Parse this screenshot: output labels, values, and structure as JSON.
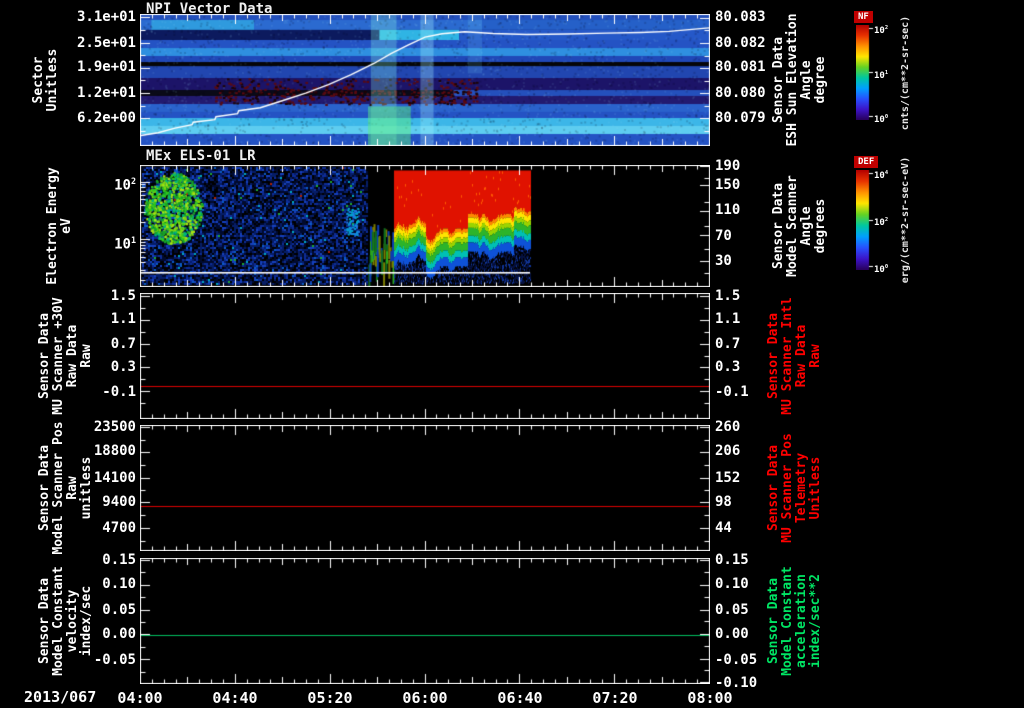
{
  "page": {
    "background": "#000000",
    "foreground": "#ffffff",
    "accent_red": "#ff0000",
    "accent_green": "#00e564"
  },
  "x_axis": {
    "date_label": "2013/067",
    "tick_labels": [
      "04:00",
      "04:40",
      "05:20",
      "06:00",
      "06:40",
      "07:20",
      "08:00"
    ]
  },
  "colorbars": [
    {
      "name": "NF",
      "units": "cnts/(cm**2-sr-sec)",
      "tick_labels": [
        "10^2",
        "10^1",
        "10^0"
      ],
      "tick_fracs": [
        0.03,
        0.5,
        0.97
      ],
      "gradient": [
        "#b40000",
        "#e83200",
        "#ff9100",
        "#ffe600",
        "#64d223",
        "#00c8a0",
        "#00a0ff",
        "#2850ff",
        "#3c14c8",
        "#28005a"
      ]
    },
    {
      "name": "DEF",
      "units": "erg/(cm**2-sr-sec-eV)",
      "tick_labels": [
        "10^4",
        "10^2",
        "10^0"
      ],
      "tick_fracs": [
        0.03,
        0.5,
        0.97
      ],
      "gradient": [
        "#b40000",
        "#e83200",
        "#ff9100",
        "#ffe600",
        "#64d223",
        "#00c8a0",
        "#00a0ff",
        "#2850ff",
        "#3c14c8",
        "#28005a"
      ]
    }
  ],
  "chart_data": [
    {
      "type": "heatmap",
      "title": "NPI Vector Data",
      "ylabel_lines": [
        "Sector",
        "Unitless"
      ],
      "y_ticks": [
        {
          "label": "3.1e+01",
          "frac": 0.023
        },
        {
          "label": "2.5e+01",
          "frac": 0.22
        },
        {
          "label": "1.9e+01",
          "frac": 0.409
        },
        {
          "label": "1.2e+01",
          "frac": 0.606
        },
        {
          "label": "6.2e+00",
          "frac": 0.795
        }
      ],
      "right_label_lines": [
        "Sensor Data",
        "ESH Sun Elevation",
        "Angle",
        "degree"
      ],
      "right_label_color": "#ffffff",
      "right_ticks": [
        {
          "label": "80.083",
          "frac": 0.03
        },
        {
          "label": "80.082",
          "frac": 0.22
        },
        {
          "label": "80.081",
          "frac": 0.409
        },
        {
          "label": "80.080",
          "frac": 0.606
        },
        {
          "label": "80.079",
          "frac": 0.795
        }
      ],
      "x_tick_labels": [
        "04:00",
        "04:40",
        "05:20",
        "06:00",
        "06:40",
        "07:20",
        "08:00"
      ],
      "description": "Sector vs time count-rate spectrogram; mostly blue/cyan horizontal bands, a full-width black row near sector 21 and a partial black row near sector 11, dark purple rows with maroon speckles between 04:30-05:30, bright cyan-green vertical enhancement near 05:50-06:05, white ESH sun-elevation trace rising from ~80.0785 deg at 04:00 to a ~80.082 deg plateau after 06:00.",
      "noise_seed": 42,
      "rows": [
        {
          "y0": 0.0,
          "y1": 0.045,
          "color": "#2450bc"
        },
        {
          "y0": 0.045,
          "y1": 0.12,
          "color": "#2b6ad0",
          "segs": [
            {
              "x0": 0.02,
              "x1": 0.2,
              "color": "#2f9ade"
            },
            {
              "x0": 0.6,
              "x1": 1.0,
              "color": "#2560c8"
            }
          ]
        },
        {
          "y0": 0.12,
          "y1": 0.197,
          "color": "#0c1a5e",
          "segs": [
            {
              "x0": 0.42,
              "x1": 0.56,
              "color": "#2fb4e4"
            },
            {
              "x0": 0.56,
              "x1": 1.0,
              "color": "#2558c8"
            }
          ]
        },
        {
          "y0": 0.197,
          "y1": 0.258,
          "color": "#2453c4"
        },
        {
          "y0": 0.258,
          "y1": 0.318,
          "color": "#2f8fe0"
        },
        {
          "y0": 0.318,
          "y1": 0.364,
          "color": "#2048b8"
        },
        {
          "y0": 0.364,
          "y1": 0.395,
          "color": "#060608"
        },
        {
          "y0": 0.395,
          "y1": 0.485,
          "color": "#2146b0"
        },
        {
          "y0": 0.485,
          "y1": 0.576,
          "color": "#1c1468",
          "noise": true
        },
        {
          "y0": 0.576,
          "y1": 0.621,
          "color": "#0a0a18",
          "noise": true,
          "segs": [
            {
              "x0": 0.55,
              "x1": 1.0,
              "color": "#2450bc"
            }
          ]
        },
        {
          "y0": 0.621,
          "y1": 0.682,
          "color": "#221a70",
          "noise": true
        },
        {
          "y0": 0.682,
          "y1": 0.742,
          "color": "#2a62cc"
        },
        {
          "y0": 0.742,
          "y1": 0.788,
          "color": "#2453c4"
        },
        {
          "y0": 0.788,
          "y1": 0.848,
          "color": "#3cb6e8"
        },
        {
          "y0": 0.848,
          "y1": 0.909,
          "color": "#5ecdf0"
        },
        {
          "y0": 0.909,
          "y1": 1.0,
          "color": "#2453c4"
        }
      ],
      "features": [
        {
          "x0": 0.405,
          "x1": 0.45,
          "y0": 0.0,
          "y1": 1.0,
          "color": "rgba(140,255,230,0.28)"
        },
        {
          "x0": 0.4,
          "x1": 0.475,
          "y0": 0.7,
          "y1": 1.0,
          "color": "rgba(90,235,130,0.50)"
        },
        {
          "x0": 0.492,
          "x1": 0.515,
          "y0": 0.0,
          "y1": 1.0,
          "color": "rgba(170,245,255,0.30)"
        },
        {
          "x0": 0.575,
          "x1": 0.6,
          "y0": 0.0,
          "y1": 0.45,
          "color": "rgba(120,220,255,0.15)"
        }
      ],
      "overlay_line": {
        "name": "ESH Sun Elevation Angle",
        "color": "#ffffff",
        "points": [
          [
            0.0,
            0.92
          ],
          [
            0.03,
            0.9
          ],
          [
            0.06,
            0.865
          ],
          [
            0.09,
            0.838
          ],
          [
            0.092,
            0.82
          ],
          [
            0.13,
            0.8
          ],
          [
            0.132,
            0.778
          ],
          [
            0.17,
            0.755
          ],
          [
            0.172,
            0.733
          ],
          [
            0.21,
            0.71
          ],
          [
            0.25,
            0.655
          ],
          [
            0.29,
            0.6
          ],
          [
            0.33,
            0.535
          ],
          [
            0.37,
            0.46
          ],
          [
            0.41,
            0.375
          ],
          [
            0.44,
            0.3
          ],
          [
            0.47,
            0.235
          ],
          [
            0.5,
            0.175
          ],
          [
            0.53,
            0.15
          ],
          [
            0.57,
            0.135
          ],
          [
            0.62,
            0.148
          ],
          [
            0.68,
            0.155
          ],
          [
            0.75,
            0.152
          ],
          [
            0.82,
            0.145
          ],
          [
            0.88,
            0.14
          ],
          [
            0.93,
            0.132
          ],
          [
            1.0,
            0.105
          ]
        ]
      }
    },
    {
      "type": "heatmap",
      "title": "MEx ELS-01 LR",
      "log_scale": true,
      "ylabel_lines": [
        "Electron Energy",
        "eV"
      ],
      "y_ticks": [
        {
          "label": "10^2",
          "frac": 0.139
        },
        {
          "label": "10^1",
          "frac": 0.615
        }
      ],
      "right_label_lines": [
        "Sensor Data",
        "Model Scanner",
        "Angle",
        "degrees"
      ],
      "right_label_color": "#ffffff",
      "right_ticks": [
        {
          "label": "190",
          "frac": 0.01
        },
        {
          "label": "150",
          "frac": 0.164
        },
        {
          "label": "110",
          "frac": 0.377
        },
        {
          "label": "70",
          "frac": 0.582
        },
        {
          "label": "30",
          "frac": 0.795
        }
      ],
      "description": "Electron energy-time spectrogram: sparse dark-blue noise 04:00-05:35 with a green-cyan enhancement near 04:05-04:20 at mid energies; intense red high-flux region ~05:45-06:45 above ~20 eV with yellow-green-cyan layers below it; data gap (black) after ~06:45; thin white trace near the panel bottom.",
      "noise_seed": 7,
      "regions": {
        "noise_end_frac": 0.4,
        "structure_start_frac": 0.445,
        "structure_end_frac": 0.685,
        "white_line_frac": 0.88
      }
    },
    {
      "type": "line",
      "ylabel_lines": [
        "Sensor Data",
        "MU Scanner +30V",
        "Raw Data",
        "Raw"
      ],
      "y_ticks": [
        {
          "label": "1.5",
          "frac": 0.024
        },
        {
          "label": "1.1",
          "frac": 0.214
        },
        {
          "label": "0.7",
          "frac": 0.405
        },
        {
          "label": "0.3",
          "frac": 0.595
        },
        {
          "label": "-0.1",
          "frac": 0.786
        }
      ],
      "right_label_lines": [
        "Sensor Data",
        "MU Scanner Intl",
        "Raw Data",
        "Raw"
      ],
      "right_label_color": "#ff0000",
      "right_ticks": [
        {
          "label": "1.5",
          "frac": 0.024
        },
        {
          "label": "1.1",
          "frac": 0.214
        },
        {
          "label": "0.7",
          "frac": 0.405
        },
        {
          "label": "0.3",
          "frac": 0.595
        },
        {
          "label": "-0.1",
          "frac": 0.786
        }
      ],
      "series": [
        {
          "name": "MU Scanner +30V Raw Data",
          "color": "#dc0000",
          "constant_value": 0.0,
          "frac": 0.738
        }
      ]
    },
    {
      "type": "line",
      "ylabel_lines": [
        "Sensor Data",
        "Model Scanner Pos",
        "Raw",
        "unitless"
      ],
      "y_ticks": [
        {
          "label": "23500",
          "frac": 0.016
        },
        {
          "label": "18800",
          "frac": 0.214
        },
        {
          "label": "14100",
          "frac": 0.421
        },
        {
          "label": "9400",
          "frac": 0.619
        },
        {
          "label": "4700",
          "frac": 0.825
        }
      ],
      "right_label_lines": [
        "Sensor Data",
        "MU Scanner Pos",
        "Telemetry",
        "Unitless"
      ],
      "right_label_color": "#ff0000",
      "right_ticks": [
        {
          "label": "260",
          "frac": 0.016
        },
        {
          "label": "206",
          "frac": 0.214
        },
        {
          "label": "152",
          "frac": 0.421
        },
        {
          "label": "98",
          "frac": 0.619
        },
        {
          "label": "44",
          "frac": 0.825
        }
      ],
      "series": [
        {
          "name": "Model Scanner Pos Raw",
          "color": "#dc0000",
          "constant_value": 8800,
          "frac": 0.645
        }
      ]
    },
    {
      "type": "line",
      "ylabel_lines": [
        "Sensor Data",
        "Model Constant",
        "velocity",
        "index/sec"
      ],
      "y_ticks": [
        {
          "label": "0.15",
          "frac": 0.016
        },
        {
          "label": "0.10",
          "frac": 0.214
        },
        {
          "label": "0.05",
          "frac": 0.413
        },
        {
          "label": "0.00",
          "frac": 0.611
        },
        {
          "label": "-0.05",
          "frac": 0.81
        }
      ],
      "right_label_lines": [
        "Sensor Data",
        "Model Constant",
        "acceleration",
        "index/sec**2"
      ],
      "right_label_color": "#00e564",
      "right_ticks": [
        {
          "label": "0.15",
          "frac": 0.016
        },
        {
          "label": "0.10",
          "frac": 0.214
        },
        {
          "label": "0.05",
          "frac": 0.413
        },
        {
          "label": "0.00",
          "frac": 0.611
        },
        {
          "label": "-0.05",
          "frac": 0.81
        },
        {
          "label": "-0.10",
          "frac": 0.995
        }
      ],
      "series": [
        {
          "name": "Model Constant velocity",
          "color": "#00c060",
          "constant_value": 0.0,
          "frac": 0.611
        }
      ]
    }
  ]
}
